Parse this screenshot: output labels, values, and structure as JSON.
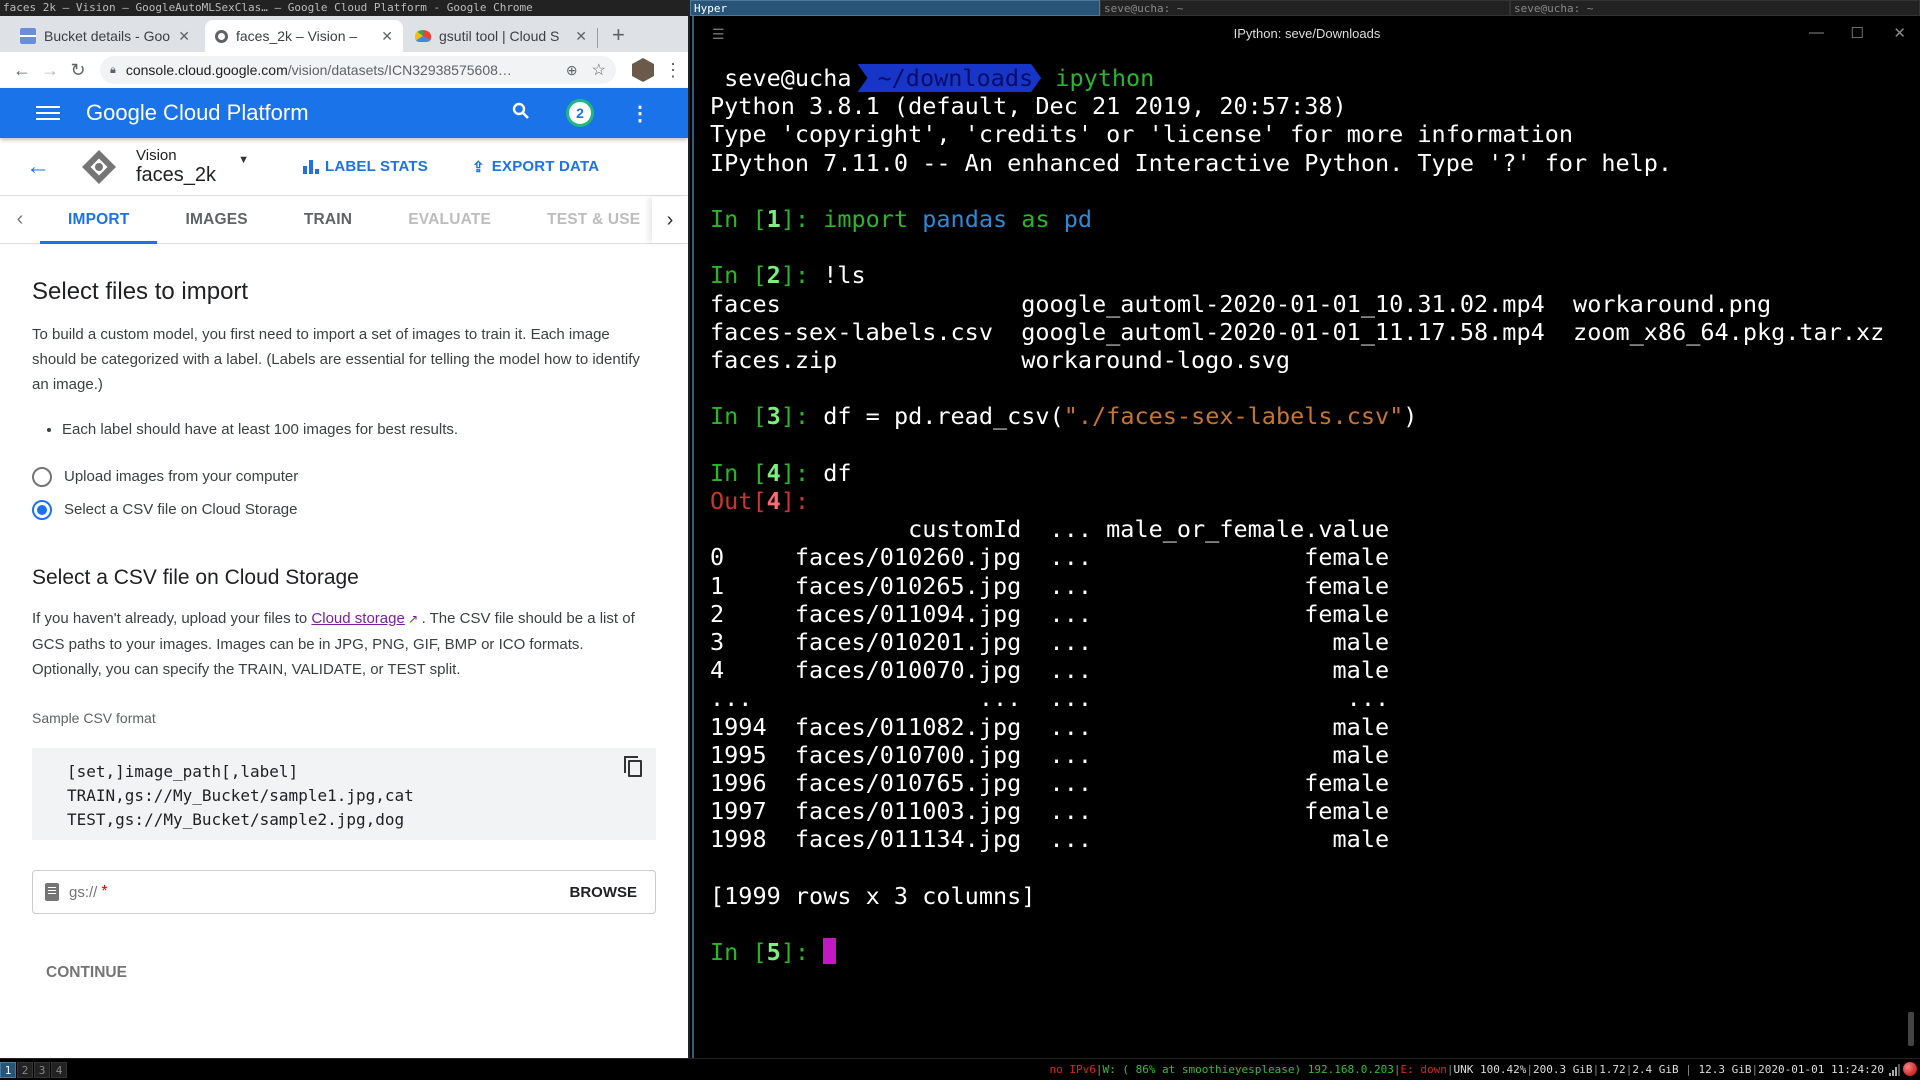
{
  "wm": {
    "left_title": "faces 2k — Vision — GoogleAutoMLSexClas… — Google Cloud Platform - Google Chrome",
    "tabs": [
      {
        "label": "Hyper",
        "active": true
      },
      {
        "label": "seve@ucha: ~",
        "active": false
      },
      {
        "label": "seve@ucha: ~",
        "active": false
      }
    ]
  },
  "chrome": {
    "tabs": [
      {
        "title": "Bucket details - Goo",
        "active": false
      },
      {
        "title": "faces_2k – Vision –",
        "active": true
      },
      {
        "title": "gsutil tool | Cloud S",
        "active": false
      }
    ],
    "url_host": "console.cloud.google.com",
    "url_path": "/vision/datasets/ICN32938575608…"
  },
  "gcp": {
    "title": "Google Cloud Platform",
    "notification_count": "2",
    "product": "Vision",
    "dataset": "faces_2k",
    "actions": {
      "label_stats": "LABEL STATS",
      "export_data": "EXPORT DATA"
    },
    "tabs": [
      {
        "label": "IMPORT",
        "state": "active"
      },
      {
        "label": "IMAGES",
        "state": "normal"
      },
      {
        "label": "TRAIN",
        "state": "normal"
      },
      {
        "label": "EVALUATE",
        "state": "disabled"
      },
      {
        "label": "TEST & USE",
        "state": "disabled"
      }
    ],
    "import": {
      "heading": "Select files to import",
      "description": "To build a custom model, you first need to import a set of images to train it. Each image should be categorized with a label. (Labels are essential for telling the model how to identify an image.)",
      "bullet": "Each label should have at least 100 images for best results.",
      "radio_upload": "Upload images from your computer",
      "radio_csv": "Select a CSV file on Cloud Storage",
      "selected": "csv",
      "csv_heading": "Select a CSV file on Cloud Storage",
      "csv_desc_pre": "If you haven't already, upload your files to ",
      "csv_link": "Cloud storage",
      "csv_desc_post": ". The CSV file should be a list of GCS paths to your images. Images can be in JPG, PNG, GIF, BMP or ICO formats. Optionally, you can specify the TRAIN, VALIDATE, or TEST split.",
      "sample_label": "Sample CSV format",
      "sample_lines": [
        "[set,]image_path[,label]",
        "TRAIN,gs://My_Bucket/sample1.jpg,cat",
        "TEST,gs://My_Bucket/sample2.jpg,dog"
      ],
      "gs_placeholder": "gs://",
      "gs_required": "*",
      "browse": "BROWSE",
      "continue": "CONTINUE"
    }
  },
  "terminal": {
    "window_title": "IPython: seve/Downloads",
    "prompt_user": "seve@ucha",
    "prompt_dir": "~/downloads",
    "prompt_cmd": "ipython",
    "banner": [
      "Python 3.8.1 (default, Dec 21 2019, 20:57:38)",
      "Type 'copyright', 'credits' or 'license' for more information",
      "IPython 7.11.0 -- An enhanced Interactive Python. Type '?' for help."
    ],
    "in1_kw1": "import",
    "in1_mod": "pandas",
    "in1_kw2": "as",
    "in1_alias": "pd",
    "in2_cmd": "!ls",
    "ls_rows": [
      [
        "faces",
        "google_automl-2020-01-01_10.31.02.mp4",
        "workaround.png"
      ],
      [
        "faces-sex-labels.csv",
        "google_automl-2020-01-01_11.17.58.mp4",
        "zoom_x86_64.pkg.tar.xz"
      ],
      [
        "faces.zip",
        "workaround-logo.svg",
        ""
      ]
    ],
    "in3_pre": "df = pd.read_csv(",
    "in3_str": "\"./faces-sex-labels.csv\"",
    "in3_post": ")",
    "in4_cmd": "df",
    "df_columns": [
      "customId",
      "...",
      "male_or_female.value"
    ],
    "df_rows": [
      [
        "0",
        "faces/010260.jpg",
        "...",
        "female"
      ],
      [
        "1",
        "faces/010265.jpg",
        "...",
        "female"
      ],
      [
        "2",
        "faces/011094.jpg",
        "...",
        "female"
      ],
      [
        "3",
        "faces/010201.jpg",
        "...",
        "male"
      ],
      [
        "4",
        "faces/010070.jpg",
        "...",
        "male"
      ],
      [
        "...",
        "...",
        "...",
        "..."
      ],
      [
        "1994",
        "faces/011082.jpg",
        "...",
        "male"
      ],
      [
        "1995",
        "faces/010700.jpg",
        "...",
        "male"
      ],
      [
        "1996",
        "faces/010765.jpg",
        "...",
        "female"
      ],
      [
        "1997",
        "faces/011003.jpg",
        "...",
        "female"
      ],
      [
        "1998",
        "faces/011134.jpg",
        "...",
        "male"
      ]
    ],
    "df_shape": "[1999 rows x 3 columns]",
    "next_prompt_num": "5"
  },
  "statusbar": {
    "workspaces": [
      "1",
      "2",
      "3",
      "4"
    ],
    "active_workspace": "1",
    "ipv6": "no IPv6",
    "wifi": "W: ( 86% at smoothieyesplease) 192.168.0.203",
    "eth": "E: down",
    "battery": "UNK 100.42%",
    "disk": "200.3 GiB",
    "load": "1.72",
    "mem": "2.4 GiB",
    "mem2": "12.3 GiB",
    "datetime": "2020-01-01 11:24:20"
  }
}
